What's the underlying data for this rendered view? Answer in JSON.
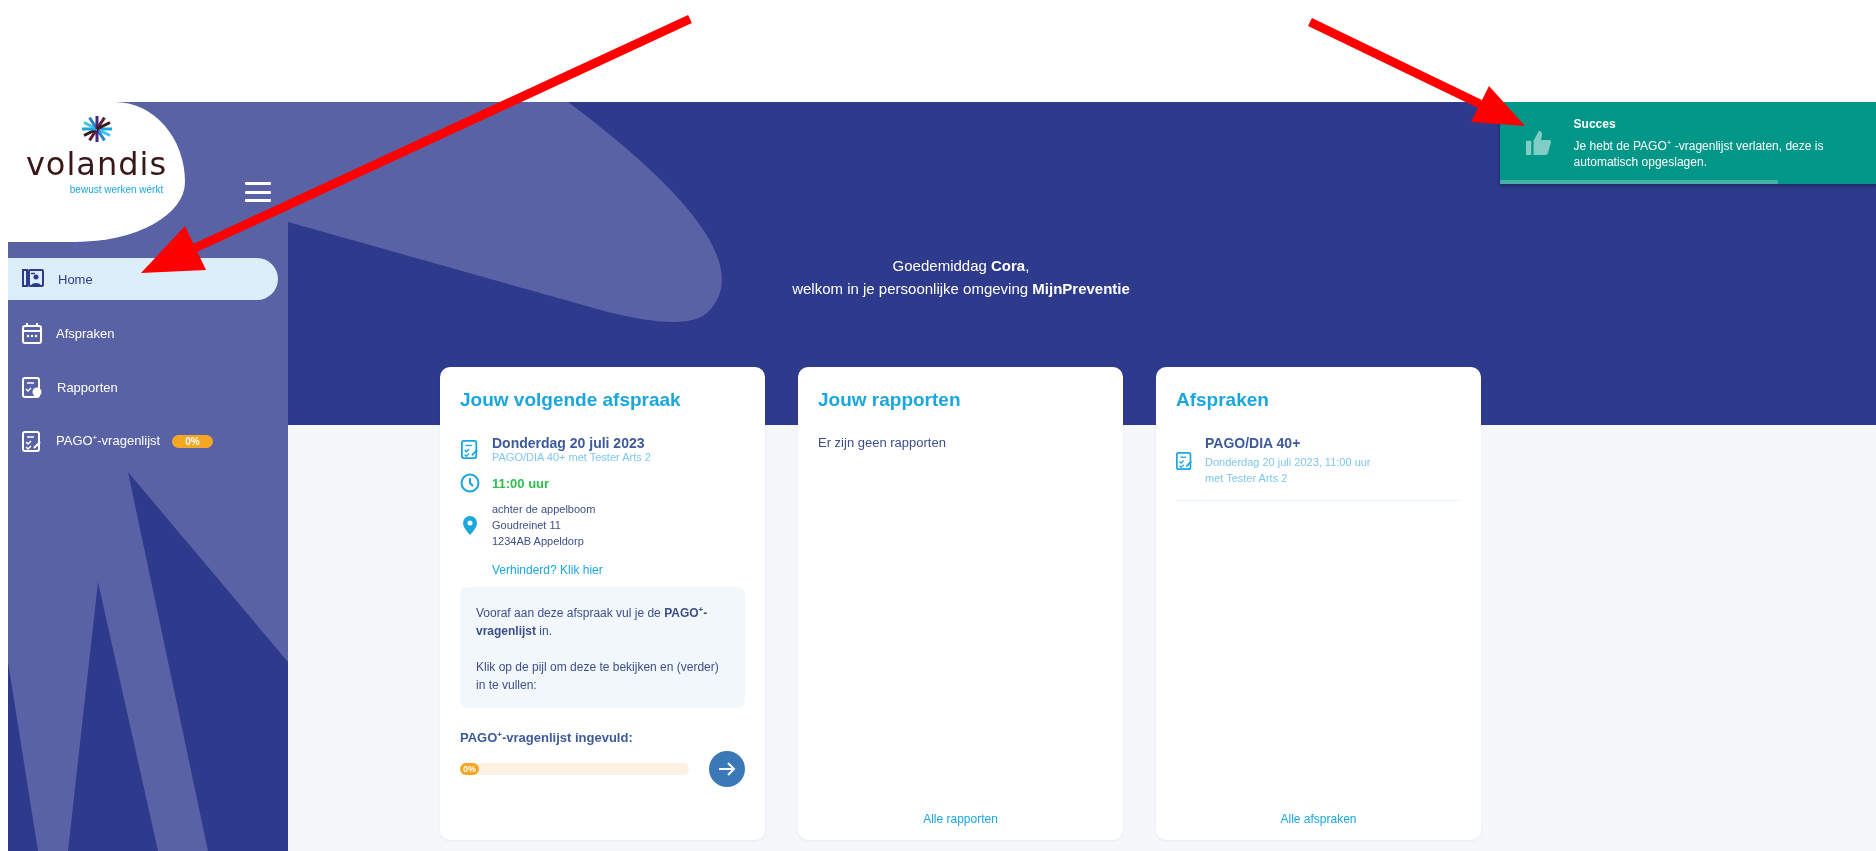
{
  "logo": {
    "name": "volandis",
    "tagline": "bewust werken wérkt"
  },
  "sidebar": {
    "items": [
      {
        "label": "Home",
        "selected": true
      },
      {
        "label": "Afspraken",
        "selected": false
      },
      {
        "label": "Rapporten",
        "selected": false
      },
      {
        "label": "PAGO$^{+}$-vragenlijst",
        "selected": false,
        "badge": "0%"
      }
    ]
  },
  "greeting": {
    "line_1": "Goedemiddag **Cora**,",
    "line_2": "welkom in je persoonlijke omgeving **MijnPreventie**"
  },
  "next_appointment": {
    "title": "Jouw volgende afspraak",
    "date": "Donderdag 20 juli 2023",
    "subtitle": "PAGO/DIA 40+ met Tester Arts 2",
    "time": "11:00 uur",
    "address": [
      "achter de appelboom",
      "Goudreinet 11",
      "1234AB Appeldorp"
    ],
    "link": "Verhinderd? Klik hier",
    "info": [
      "Vooraf aan deze afspraak vul je de **PAGO$^{+}$-vragenlijst** in.",
      "Klik op de pijl om deze te bekijken en (verder) in te vullen:"
    ],
    "progress": {
      "label": "PAGO$^{+}$-vragenlijst ingevuld:",
      "reading": "0%",
      "level": 0
    }
  },
  "reports": {
    "title": "Jouw rapporten",
    "empty": "Er zijn geen rapporten",
    "link": "Alle rapporten"
  },
  "appointments": {
    "title": "Afspraken",
    "items": [
      {
        "title": "PAGO/DIA 40+",
        "details": "Donderdag 20 juli 2023, 11:00 uur",
        "with": "met Tester Arts 2"
      }
    ],
    "link": "Alle afspraken"
  },
  "toast": {
    "title": "Succes",
    "message": "Je hebt de PAGO$^{+}$ -vragenlijst verlaten, deze is automatisch opgeslagen.",
    "level": 0.74
  }
}
